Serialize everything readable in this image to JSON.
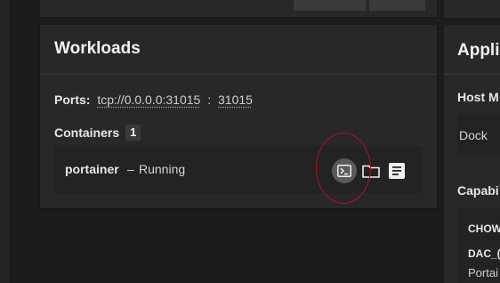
{
  "workloads": {
    "title": "Workloads",
    "ports_label": "Ports:",
    "ports": [
      "tcp://0.0.0.0:31015",
      "31015"
    ],
    "port_separator": ":",
    "containers_label": "Containers",
    "containers_count": "1",
    "container": {
      "name": "portainer",
      "separator": "–",
      "status": "Running",
      "actions": {
        "shell_icon": "terminal-icon",
        "volumes_icon": "folder-icon",
        "logs_icon": "logs-icon"
      }
    }
  },
  "right_panel": {
    "title": "Appli",
    "host_label": "Host M",
    "host_value": "Dock",
    "capabilities_label": "Capabi",
    "capabilities": [
      "CHOW",
      "DAC_("
    ],
    "capability_desc": "Portai"
  },
  "colors": {
    "background": "#1c1c1c",
    "card": "#282828",
    "highlight_annotation": "#b3121c"
  }
}
